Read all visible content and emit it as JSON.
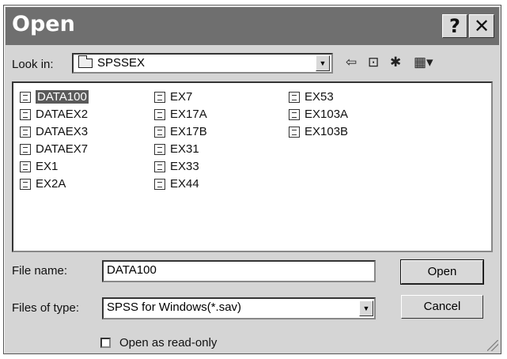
{
  "dialog": {
    "title": "Open",
    "help_label": "?",
    "close_label": "✕"
  },
  "lookin": {
    "label": "Look in:",
    "value": "SPSSEX"
  },
  "toolbar": {
    "back_icon": "back-arrow-icon",
    "up_icon": "up-folder-icon",
    "new_folder_icon": "new-folder-icon",
    "view_menu_icon": "view-menu-icon"
  },
  "files": [
    {
      "name": "DATA100",
      "selected": true
    },
    {
      "name": "DATAEX2"
    },
    {
      "name": "DATAEX3"
    },
    {
      "name": "DATAEX7"
    },
    {
      "name": "EX1"
    },
    {
      "name": "EX2A"
    },
    {
      "name": "EX7"
    },
    {
      "name": "EX17A"
    },
    {
      "name": "EX17B"
    },
    {
      "name": "EX31"
    },
    {
      "name": "EX33"
    },
    {
      "name": "EX44"
    },
    {
      "name": "EX53"
    },
    {
      "name": "EX103A"
    },
    {
      "name": "EX103B"
    }
  ],
  "filename": {
    "label": "File name:",
    "value": "DATA100"
  },
  "filetype": {
    "label": "Files of type:",
    "value": "SPSS for Windows(*.sav)"
  },
  "buttons": {
    "open": "Open",
    "cancel": "Cancel"
  },
  "readonly": {
    "label": "Open as read-only",
    "checked": false
  }
}
